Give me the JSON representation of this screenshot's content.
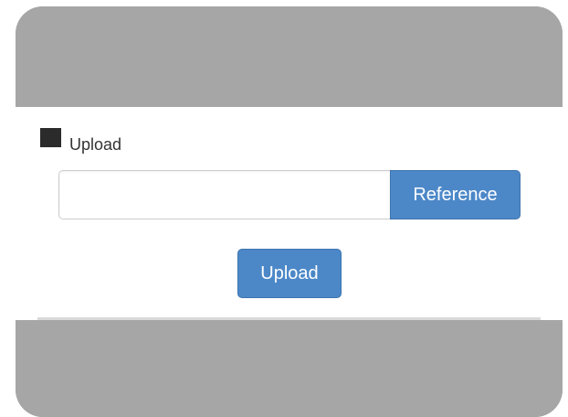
{
  "upload_section": {
    "heading_label": "Upload",
    "icon": "square-icon",
    "file_input": {
      "value": "",
      "placeholder": ""
    },
    "reference_button_label": "Reference",
    "upload_button_label": "Upload"
  },
  "colors": {
    "background_band": "#a6a6a6",
    "panel": "#ffffff",
    "button_primary": "#4c88c8",
    "button_text": "#ffffff",
    "icon_square": "#2b2b2b"
  }
}
